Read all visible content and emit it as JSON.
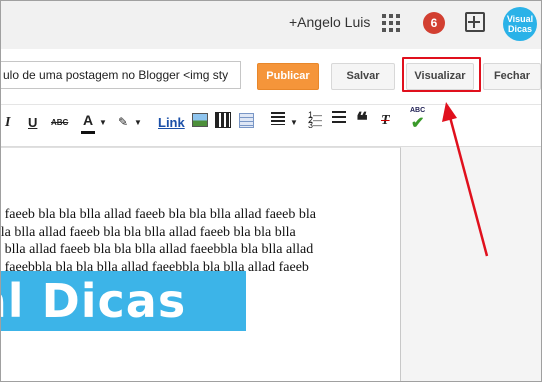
{
  "header": {
    "username": "+Angelo Luis",
    "notification_count": "6",
    "avatar_text": "Visual Dicas"
  },
  "post": {
    "title_value": "ulo de uma postagem no Blogger <img sty"
  },
  "buttons": {
    "publish": "Publicar",
    "save": "Salvar",
    "preview": "Visualizar",
    "close": "Fechar"
  },
  "toolbar": {
    "italic": "I",
    "underline": "U",
    "strikethrough": "ABC",
    "text_color": "A",
    "link": "Link",
    "quote": "❝",
    "clear_format": "T",
    "spell_check": "ABC",
    "icons": [
      "italic-icon",
      "underline-icon",
      "strikethrough-icon",
      "text-color-icon",
      "highlight-color-icon",
      "link",
      "insert-image-icon",
      "insert-video-icon",
      "jump-break-icon",
      "align-icon",
      "numbered-list-icon",
      "bulleted-list-icon",
      "quote-icon",
      "clear-formatting-icon",
      "spell-check-icon"
    ]
  },
  "editor": {
    "lines": [
      "lad faeeb bla bla blla allad faeeb bla bla blla allad faeeb bla",
      "a bla blla allad faeeb bla bla blla allad faeeb bla bla blla",
      "bla blla allad faeeb bla bla blla allad faeebbla bla blla allad",
      "lad faeebbla bla bla blla allad faeebbla bla blla allad faeeb"
    ],
    "banner_text": "ual Dicas"
  },
  "colors": {
    "publish": "#f5953a",
    "highlight_box": "#e0101d",
    "banner": "#3cb4e8",
    "notification": "#d23f31"
  }
}
